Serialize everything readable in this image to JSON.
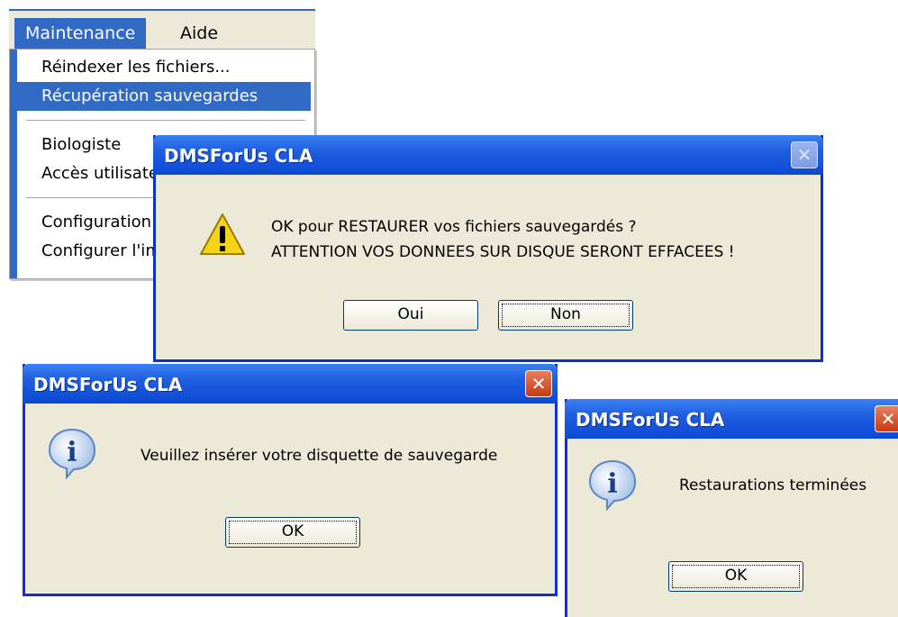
{
  "menu": {
    "items": [
      {
        "label": "Maintenance"
      },
      {
        "label": "Aide"
      }
    ],
    "dropdown": [
      {
        "label": "Réindexer les fichiers..."
      },
      {
        "label": "Récupération sauvegardes"
      },
      {
        "label": "Biologiste"
      },
      {
        "label": "Accès utilisateurs"
      },
      {
        "label": "Configuration"
      },
      {
        "label": "Configurer l'imprimante"
      }
    ]
  },
  "dialogs": {
    "confirm": {
      "title": "DMSForUs CLA",
      "line1": "OK pour RESTAURER vos fichiers sauvegardés ?",
      "line2": "ATTENTION VOS DONNEES SUR DISQUE SERONT EFFACEES !",
      "yes_label": "Oui",
      "no_label": "Non",
      "icon": "warning-icon"
    },
    "insert": {
      "title": "DMSForUs CLA",
      "message": "Veuillez insérer votre disquette de sauvegarde",
      "ok_label": "OK",
      "icon": "info-icon"
    },
    "done": {
      "title": "DMSForUs CLA",
      "message": "Restaurations terminées",
      "ok_label": "OK",
      "icon": "info-icon"
    }
  },
  "colors": {
    "title_blue": "#0b49d4",
    "selection": "#316ac5",
    "dialog_bg": "#ece9d8",
    "close_red": "#c53b13"
  }
}
